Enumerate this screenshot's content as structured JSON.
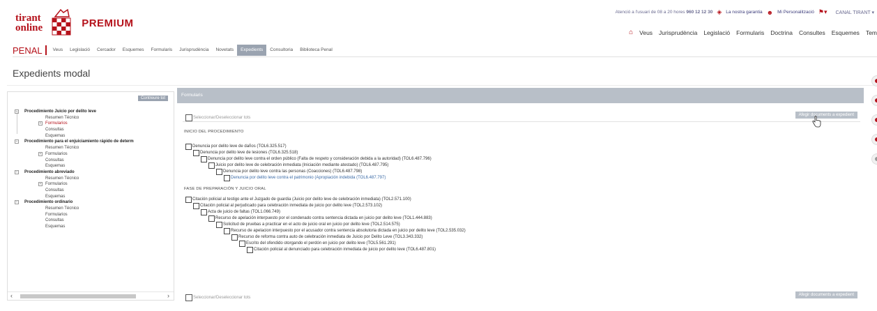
{
  "header": {
    "logo_line1": "tirant",
    "logo_line2": "online",
    "premium": "PREMIUM",
    "topbar": {
      "hours": "Atenció a l'usuari de 08 a 20 hores",
      "phone": "960 12 12 30",
      "guarantee": "La nostra garantia",
      "personal": "Mi Personalització",
      "canal": "CANAL TIRANT"
    },
    "mainnav": [
      "Veus",
      "Jurisprudència",
      "Legislació",
      "Formularis",
      "Doctrina",
      "Consultes",
      "Esquemes",
      "Tem"
    ]
  },
  "subnav": {
    "section": "PENAL",
    "items": [
      "Veus",
      "Legislació",
      "Cercador",
      "Esquemes",
      "Formularis",
      "Jurisprudència",
      "Novetats",
      "Expedients",
      "Consultoria",
      "Biblioteca Penal"
    ],
    "active": "Expedients"
  },
  "page_title": "Expedients modal",
  "sidebar": {
    "collapse_label": "Contreure tot",
    "groups": [
      {
        "title": "Procedimiento Juicio por delito leve",
        "children": [
          "Resumen Técnico",
          "Formularios",
          "Consultas",
          "Esquemas"
        ],
        "expandable": "Formularios",
        "selected": "Formularios"
      },
      {
        "title": "Procedimiento para el enjuiciamiento rápido de determ",
        "children": [
          "Resumen Técnico",
          "Formularios",
          "Consultas",
          "Esquemas"
        ],
        "expandable": "Formularios"
      },
      {
        "title": "Procedimiento abreviado",
        "children": [
          "Resumen Técnico",
          "Formularios",
          "Consultas",
          "Esquemas"
        ],
        "expandable": "Formularios"
      },
      {
        "title": "Procedimiento ordinario",
        "children": [
          "Resumen Técnico",
          "Formularios",
          "Consultas",
          "Esquemas"
        ]
      }
    ]
  },
  "panel": {
    "title": "Formularis",
    "select_all": "Seleccionar/Deseleccionar tots",
    "add_button": "Afegir documents a expedient",
    "sections": [
      {
        "title": "INICIO DEL PROCEDIMIENTO",
        "docs": [
          "Denuncia por delito leve de daños (TOL6.325.517)",
          "Denuncia por delito leve de lesiones (TOL6.325.518)",
          "Denuncia por delito leve contra el orden público (Falta de respeto y consideración debida a la autoridad) (TOL6.487.796)",
          "Juicio por delito leve de celebración inmediata (Iniciación mediante atestado) (TOL6.487.795)",
          "Denuncia por delito leve contra las personas (Coacciones) (TOL6.487.798)",
          "Denuncia por delito leve contra el patrimonio (Apropiación indebida (TOL6.487.797)"
        ]
      },
      {
        "title": "FASE DE PREPARACIÓN Y JUICIO ORAL",
        "docs": [
          "Citación policial al testigo ante el Juzgado de guardia (Juicio por delito leve de celebración inmediata) (TOL2.571.100)",
          "Citación policial al perjudicado para celebración inmediata de juicio por delito leve (TOL2.573.102)",
          "Acta de juicio de faltas (TOL1.066.749)",
          "Recurso de apelación interpuesto por el condenado contra sentencia dictada en juicio por delito leve (TOL1.444.883)",
          "Solicitud de pruebas a practicar en el acto de juicio oral en juicio por delito leve (TOL2.514.575)",
          "Recurso de apelacion interpuesto por el acusador contra sentencia absolutoria dictada en juicio por delito leve (TOL2.535.032)",
          "Recurso de reforma contra auto de celebración inmediata de Juicio por Delito Leve (TOL3.343.332)",
          "Escrito del ofendido otorgando el perdón en juicio por delito leve (TOL5.561.291)",
          "Citación policial al denunciado para celebración inmediata de juicio por delito leve (TOL6.487.801)"
        ]
      }
    ]
  },
  "colors": {
    "brand_red": "#b5121b",
    "panel_gray": "#b8bfc8",
    "link_blue": "#3a6aa6"
  }
}
